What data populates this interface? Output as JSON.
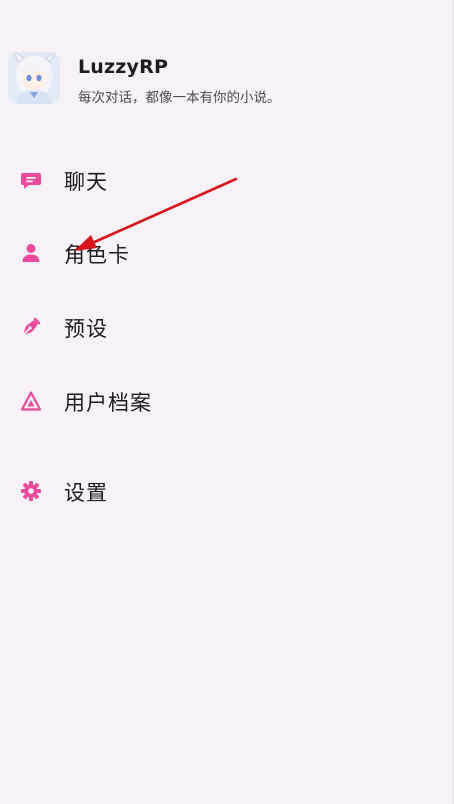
{
  "app": {
    "name": "LuzzyRP",
    "tagline": "每次对话，都像一本有你的小说。"
  },
  "colors": {
    "accent": "#ec4a9c",
    "drawer_bg": "#f8f2f8",
    "annotation_arrow": "#d8151b"
  },
  "nav": {
    "items": [
      {
        "label": "聊天",
        "icon": "chat-bubble-icon"
      },
      {
        "label": "角色卡",
        "icon": "person-icon"
      },
      {
        "label": "预设",
        "icon": "pen-nib-icon"
      },
      {
        "label": "用户档案",
        "icon": "triangle-profile-icon"
      },
      {
        "label": "设置",
        "icon": "gear-icon"
      }
    ]
  }
}
